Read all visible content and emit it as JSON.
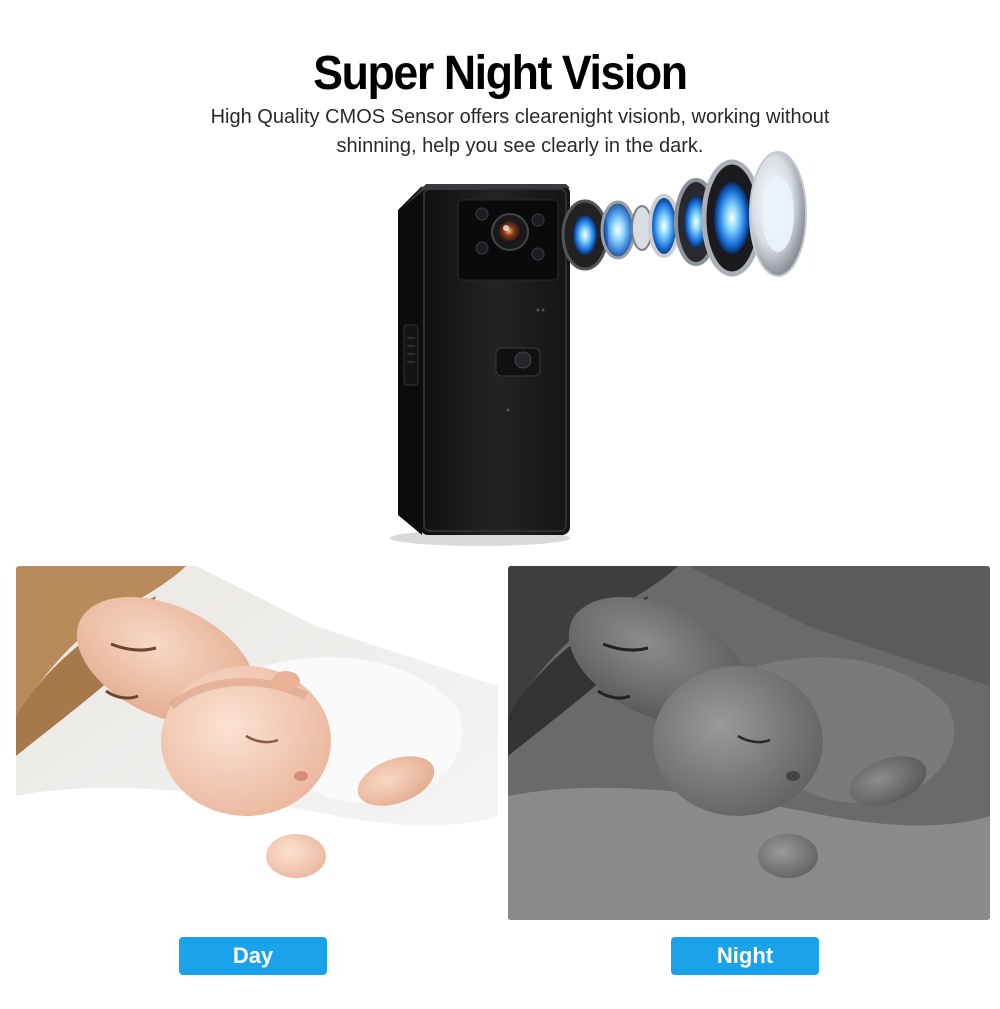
{
  "header": {
    "title": "Super Night Vision",
    "subtitle": "High Quality CMOS Sensor offers clearenight visionb, working without shinning, help you see clearly in the dark."
  },
  "hero": {
    "description": "mini-camera-with-exploded-lens"
  },
  "comparison": {
    "day_label": "Day",
    "night_label": "Night"
  },
  "colors": {
    "accent": "#1aa2ea",
    "lens_glow": "#1e90ff",
    "camera_body": "#1b1b1d"
  }
}
